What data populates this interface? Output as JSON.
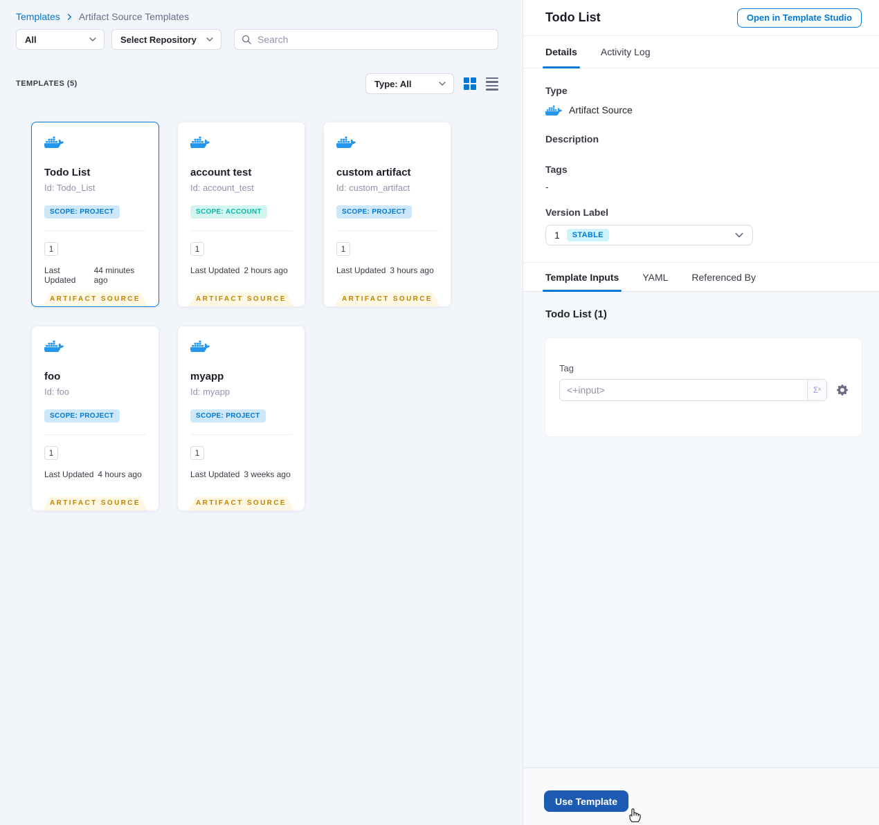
{
  "colors": {
    "primary_blue": "#0278d5",
    "docker_blue": "#2496ed",
    "use_template_blue": "#1d5ab2",
    "scope_project_bg": "#cde8fb",
    "scope_account_bg": "#d3f7f0",
    "scope_account_text": "#09b5a6",
    "stable_badge_bg": "#cdf4fe",
    "ribbon_bg": "#fdf7e3",
    "ribbon_text": "#c18401"
  },
  "breadcrumb": {
    "root": "Templates",
    "current": "Artifact Source Templates"
  },
  "filters": {
    "scope": "All",
    "repository": "Select Repository",
    "search_placeholder": "Search",
    "type": "Type: All"
  },
  "list_header": "TEMPLATES (5)",
  "card_labels": {
    "last_updated": "Last Updated",
    "ribbon": "ARTIFACT SOURCE"
  },
  "cards": [
    {
      "title": "Todo List",
      "id": "Id: Todo_List",
      "scope": "SCOPE: PROJECT",
      "version_count": "1",
      "last_updated": "44 minutes ago"
    },
    {
      "title": "account test",
      "id": "Id: account_test",
      "scope": "SCOPE: ACCOUNT",
      "version_count": "1",
      "last_updated": "2 hours ago"
    },
    {
      "title": "custom artifact",
      "id": "Id: custom_artifact",
      "scope": "SCOPE: PROJECT",
      "version_count": "1",
      "last_updated": "3 hours ago"
    },
    {
      "title": "foo",
      "id": "Id: foo",
      "scope": "SCOPE: PROJECT",
      "version_count": "1",
      "last_updated": "4 hours ago"
    },
    {
      "title": "myapp",
      "id": "Id: myapp",
      "scope": "SCOPE: PROJECT",
      "version_count": "1",
      "last_updated": "3 weeks ago"
    }
  ],
  "panel": {
    "title": "Todo List",
    "open_studio": "Open in Template Studio",
    "tabs": {
      "details": "Details",
      "activity_log": "Activity Log"
    },
    "type_label": "Type",
    "type_value": "Artifact Source",
    "description_label": "Description",
    "tags_label": "Tags",
    "tags_value": "-",
    "version_label": "Version Label",
    "version_value": "1",
    "version_badge": "STABLE",
    "subtabs": {
      "inputs": "Template Inputs",
      "yaml": "YAML",
      "referenced": "Referenced By"
    },
    "inputs_heading": "Todo List (1)",
    "tag_label": "Tag",
    "tag_value": "<+input>",
    "expression_glyph": "Σˣ",
    "use_template": "Use Template"
  }
}
